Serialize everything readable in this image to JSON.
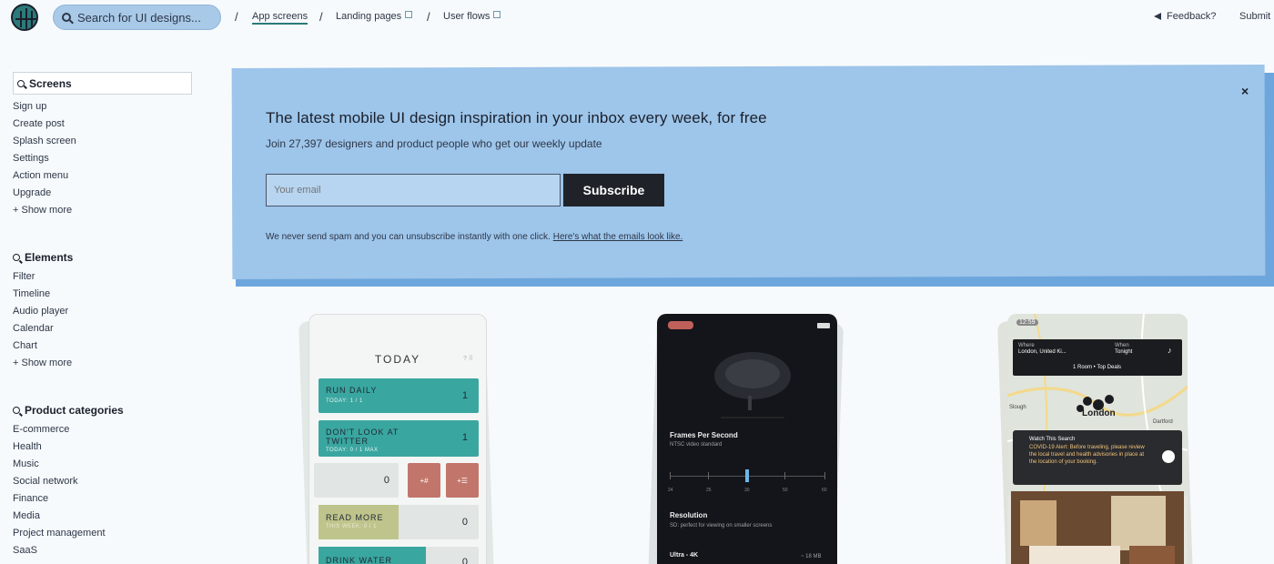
{
  "topbar": {
    "search_placeholder": "Search for UI designs...",
    "nav": [
      {
        "label": "App screens"
      },
      {
        "label": "Landing pages"
      },
      {
        "label": "User flows"
      }
    ],
    "feedback": "Feedback?",
    "submit": "Submit"
  },
  "sidebar": {
    "screens": {
      "heading": "Screens",
      "items": [
        "Sign up",
        "Create post",
        "Splash screen",
        "Settings",
        "Action menu",
        "Upgrade"
      ],
      "more": "+ Show more"
    },
    "elements": {
      "heading": "Elements",
      "items": [
        "Filter",
        "Timeline",
        "Audio player",
        "Calendar",
        "Chart"
      ],
      "more": "+ Show more"
    },
    "categories": {
      "heading": "Product categories",
      "items": [
        "E-commerce",
        "Health",
        "Music",
        "Social network",
        "Finance",
        "Media",
        "Project management",
        "SaaS"
      ]
    }
  },
  "banner": {
    "title": "The latest mobile UI design inspiration in your inbox every week, for free",
    "subtitle": "Join 27,397 designers and product people who get our weekly update",
    "email_placeholder": "Your email",
    "subscribe": "Subscribe",
    "note": "We never send spam and you can unsubscribe instantly with one click.",
    "note_link": "Here's what the emails look like.",
    "close": "×"
  },
  "cards": {
    "p1": {
      "title": "TODAY",
      "tasks": [
        {
          "name": "RUN DAILY",
          "sub": "TODAY: 1 / 1",
          "count": "1"
        },
        {
          "name": "DON'T LOOK AT TWITTER",
          "sub": "TODAY: 0 / 1 MAX",
          "count": "1"
        },
        {
          "name": "READ MORE",
          "sub": "THIS WEEK: 0 / 1",
          "count": "0"
        },
        {
          "name": "DRINK WATER",
          "sub": "",
          "count": "0"
        }
      ],
      "tile_count": "0",
      "tile_a": "+#",
      "tile_b": "+☰"
    },
    "p2": {
      "fps_title": "Frames Per Second",
      "fps_sub": "NTSC video standard",
      "scale": [
        "24",
        "25",
        "30",
        "50",
        "60"
      ],
      "res_title": "Resolution",
      "res_sub": "SD: perfect for viewing on smaller screens",
      "ultra": "Ultra - 4K",
      "ultra_size": "~ 18 MB"
    },
    "p3": {
      "time": "12:59",
      "where_label": "Where",
      "where": "London, United Ki...",
      "when_label": "When",
      "when": "Tonight",
      "rooms": "1 Room • Top Deals",
      "city": "London",
      "slough": "Slough",
      "dartford": "Dartford",
      "alert_title": "Watch This Search",
      "alert_text": "COVID-19 Alert: Before traveling, please review the local travel and health advisories in place at the location of your booking."
    }
  },
  "colors": {
    "banner": "#9ec5ea",
    "teal": "#3aa6a0",
    "accent": "#2c7a7b"
  }
}
